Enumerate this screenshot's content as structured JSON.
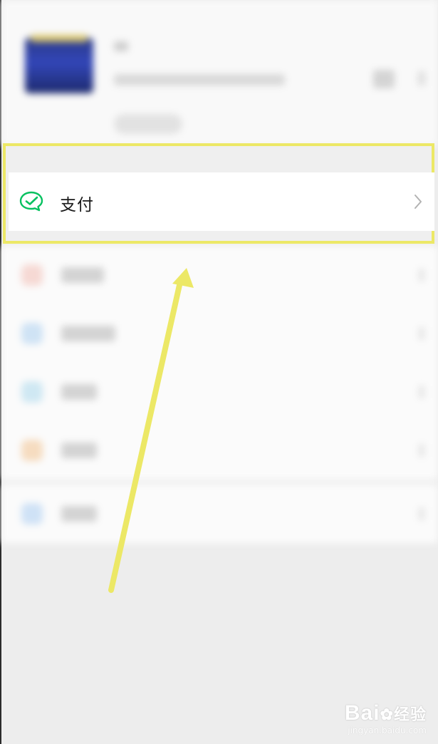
{
  "menu": {
    "pay_label": "支付"
  },
  "colors": {
    "pay_icon_green": "#07c160",
    "highlight_yellow": "#ece866",
    "chevron_gray": "#b2b2b2"
  },
  "icons": {
    "pay": "wechat-pay-icon",
    "chevron": "chevron-right-icon"
  },
  "watermark": {
    "brand": "Bai",
    "brand_suffix": "经验",
    "sub": "jingyan.baidu.com"
  }
}
